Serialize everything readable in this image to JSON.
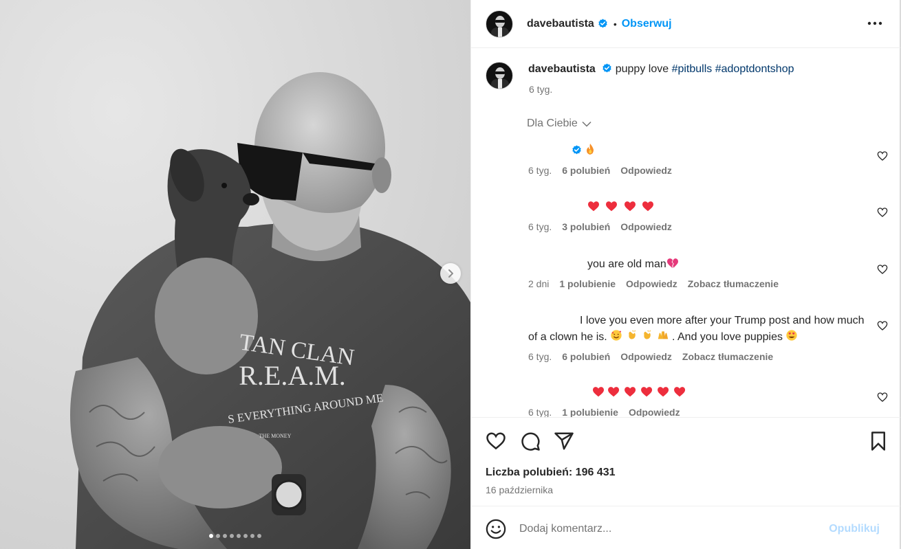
{
  "post": {
    "author": "davebautista",
    "follow_label": "Obserwuj",
    "separator": "•",
    "more_icon": "more-horizontal-icon",
    "carousel": {
      "slide_count": 8,
      "active_index": 0,
      "next_icon": "chevron-right-icon"
    },
    "photo_text": {
      "line1": "TAN CLAN",
      "line2": "R.E.A.M.",
      "line3": "S EVERYTHING AROUND ME",
      "line4": "THE MONEY"
    }
  },
  "caption": {
    "author": "davebautista",
    "text": "puppy love",
    "hashtag1": "#pitbulls",
    "hashtag2": "#adoptdontshop",
    "time": "6 tyg."
  },
  "filter": {
    "label": "Dla Ciebie"
  },
  "comments": [
    {
      "body": "",
      "emoji": [
        "verified-badge",
        "fire"
      ],
      "time": "6 tyg.",
      "likes": "6 polubień",
      "reply": "Odpowiedz"
    },
    {
      "body": "",
      "emoji": [
        "heart",
        "heart",
        "heart",
        "heart"
      ],
      "time": "6 tyg.",
      "likes": "3 polubień",
      "reply": "Odpowiedz"
    },
    {
      "body": "you are old man",
      "emoji": [
        "broken-heart"
      ],
      "time": "2 dni",
      "likes": "1 polubienie",
      "reply": "Odpowiedz",
      "translate": "Zobacz tłumaczenie"
    },
    {
      "body_part1": "I love you even more after your Trump post and how",
      "body_part2": "much of a clown he is.",
      "body_part3": ". And you love puppies",
      "emoji": [
        "smiling-hearts",
        "clap",
        "clap",
        "raised-hands",
        "heart-eyes"
      ],
      "time": "6 tyg.",
      "likes": "6 polubień",
      "reply": "Odpowiedz",
      "translate": "Zobacz tłumaczenie"
    },
    {
      "body": "",
      "emoji": [
        "heart",
        "heart",
        "heart",
        "heart",
        "heart",
        "heart"
      ],
      "time": "6 tyg.",
      "likes": "1 polubienie",
      "reply": "Odpowiedz"
    }
  ],
  "actions": {
    "likes_label": "Liczba polubień: 196 431",
    "date": "16 października"
  },
  "add_comment": {
    "placeholder": "Dodaj komentarz...",
    "publish": "Opublikuj"
  },
  "colors": {
    "link": "#0095f6",
    "hashtag": "#00376b",
    "muted": "#737373",
    "heart": "#ed2e3d",
    "verified": "#0095f6",
    "publish_disabled": "#b3dbff"
  }
}
